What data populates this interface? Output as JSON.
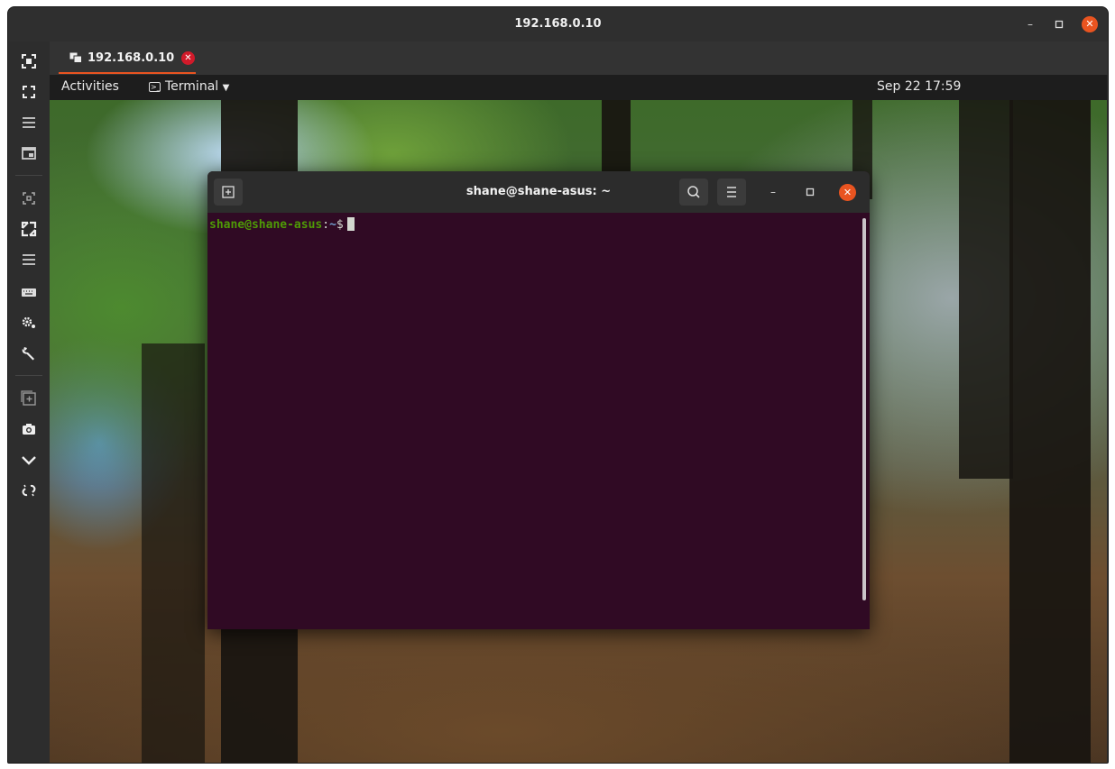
{
  "window": {
    "title": "192.168.0.10"
  },
  "tab": {
    "label": "192.168.0.10"
  },
  "sidebar": {
    "icons": [
      "screenshot-frame-icon",
      "fullscreen-icon",
      "menu-lines-icon",
      "window-display-icon",
      "scale-frame-icon",
      "fit-screen-icon",
      "menu-lines-icon",
      "keyboard-icon",
      "gears-icon",
      "wrench-icon",
      "new-tab-icon",
      "camera-icon",
      "chevron-down-icon",
      "disconnect-icon"
    ]
  },
  "gnome": {
    "activities": "Activities",
    "app_name": "Terminal",
    "clock": "Sep 22  17:59"
  },
  "terminal": {
    "title": "shane@shane-asus: ~",
    "prompt_user": "shane@shane-asus",
    "prompt_sep": ":",
    "prompt_path": "~",
    "prompt_sign": "$"
  },
  "colors": {
    "accent": "#e95420",
    "terminal_bg": "#300a24",
    "tab_close": "#d11a2a"
  }
}
